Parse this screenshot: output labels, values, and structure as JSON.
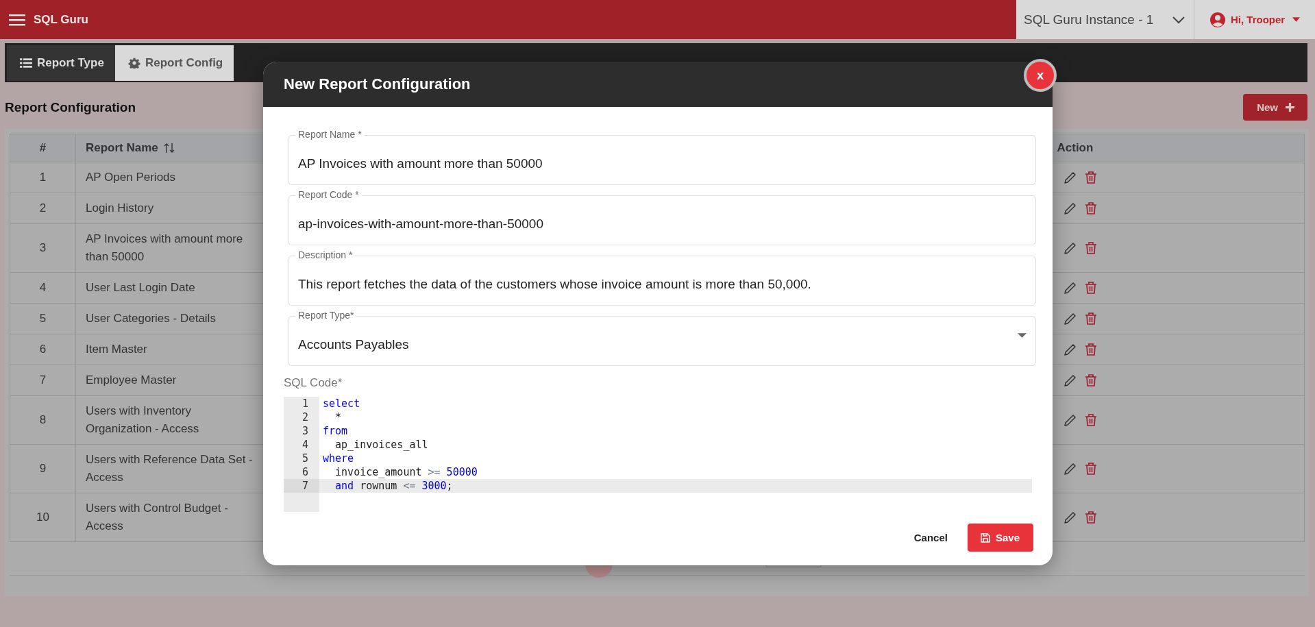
{
  "app": {
    "title": "SQL Guru",
    "instance": "SQL Guru Instance - 1",
    "user": "Hi, Trooper"
  },
  "tabs": [
    {
      "label": "Report Type",
      "selected": false
    },
    {
      "label": "Report Config",
      "selected": true
    }
  ],
  "page": {
    "heading": "Report Configuration",
    "new_button": "New"
  },
  "table": {
    "columns": [
      {
        "label": "#",
        "sortable": false
      },
      {
        "label": "Report Name",
        "sortable": true
      },
      {
        "label": "Action",
        "sortable": false
      }
    ],
    "rows": [
      {
        "number": "1",
        "name": "AP Open Periods"
      },
      {
        "number": "2",
        "name": "Login History"
      },
      {
        "number": "3",
        "name": "AP Invoices with amount more than 50000"
      },
      {
        "number": "4",
        "name": "User Last Login Date"
      },
      {
        "number": "5",
        "name": "User Categories - Details"
      },
      {
        "number": "6",
        "name": "Item Master"
      },
      {
        "number": "7",
        "name": "Employee Master"
      },
      {
        "number": "8",
        "name": "Users with Inventory Organization - Access"
      },
      {
        "number": "9",
        "name": "Users with Reference Data Set - Access"
      },
      {
        "number": "10",
        "name": "Users with Control Budget - Access"
      }
    ]
  },
  "modal": {
    "title": "New Report Configuration",
    "close": "x",
    "fields": [
      {
        "label": "Report Name *",
        "value": "AP Invoices with amount more than 50000",
        "kind": "text"
      },
      {
        "label": "Report Code *",
        "value": "ap-invoices-with-amount-more-than-50000",
        "kind": "text"
      },
      {
        "label": "Description *",
        "value": "This report fetches the data of the customers whose invoice amount is more than 50,000.",
        "kind": "text"
      },
      {
        "label": "Report Type*",
        "value": "Accounts Payables",
        "kind": "select"
      }
    ],
    "sql": {
      "label": "SQL Code*",
      "lines": [
        {
          "number": "1",
          "active": false,
          "indented": false,
          "tokens": [
            {
              "text": "select",
              "kind": "keyword"
            }
          ]
        },
        {
          "number": "2",
          "active": false,
          "indented": true,
          "tokens": [
            {
              "text": "*",
              "kind": "plain"
            }
          ]
        },
        {
          "number": "3",
          "active": false,
          "indented": false,
          "tokens": [
            {
              "text": "from",
              "kind": "keyword"
            }
          ]
        },
        {
          "number": "4",
          "active": false,
          "indented": true,
          "tokens": [
            {
              "text": "ap_invoices_all",
              "kind": "plain"
            }
          ]
        },
        {
          "number": "5",
          "active": false,
          "indented": false,
          "tokens": [
            {
              "text": "where",
              "kind": "keyword"
            }
          ]
        },
        {
          "number": "6",
          "active": false,
          "indented": true,
          "tokens": [
            {
              "text": "invoice_amount ",
              "kind": "plain"
            },
            {
              "text": ">=",
              "kind": "operator"
            },
            {
              "text": " 50000",
              "kind": "number"
            }
          ]
        },
        {
          "number": "7",
          "active": true,
          "indented": true,
          "tokens": [
            {
              "text": "and",
              "kind": "keyword"
            },
            {
              "text": " rownum ",
              "kind": "plain"
            },
            {
              "text": "<=",
              "kind": "operator"
            },
            {
              "text": " 3000",
              "kind": "number"
            },
            {
              "text": ";",
              "kind": "plain"
            }
          ]
        }
      ]
    },
    "cancel": "Cancel",
    "save": "Save"
  }
}
